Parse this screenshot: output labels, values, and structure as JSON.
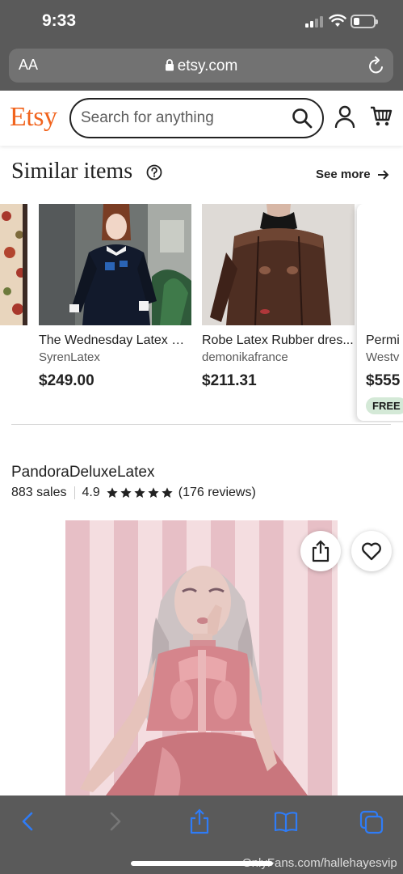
{
  "status_bar": {
    "time": "9:33",
    "battery_level": 0.3
  },
  "browser": {
    "text_size_label": "AA",
    "url": "etsy.com"
  },
  "etsy": {
    "logo": "Etsy",
    "search": {
      "placeholder": "Search for anything"
    },
    "brand_color": "#f1641e"
  },
  "similar": {
    "title": "Similar items",
    "see_more": "See more",
    "items": [
      {
        "title": "The Wednesday Latex D...",
        "shop": "SyrenLatex",
        "price": "$249.00"
      },
      {
        "title": "Robe Latex Rubber dres...",
        "shop": "demonikafrance",
        "price": "$211.31"
      },
      {
        "title": "Permi",
        "shop": "Westv",
        "price": "$555",
        "badge": "FREE"
      }
    ]
  },
  "shop": {
    "name": "PandoraDeluxeLatex",
    "sales": "883 sales",
    "rating": "4.9",
    "stars": 5,
    "reviews": "(176 reviews)"
  },
  "toolbar": {
    "icons": [
      "back-icon",
      "forward-icon",
      "share-icon",
      "bookmarks-icon",
      "tabs-icon"
    ],
    "accent": "#2f7cf6"
  },
  "watermark": "OnlyFans.com/hallehayesvip"
}
